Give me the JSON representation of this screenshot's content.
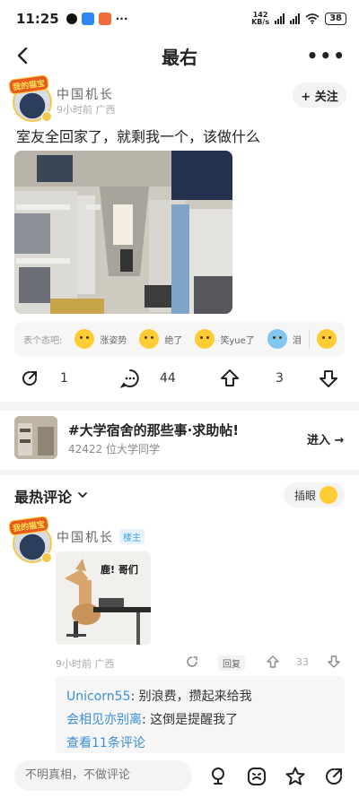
{
  "status": {
    "time": "11:25",
    "net_rate": "142",
    "net_unit": "KB/s",
    "battery": "38"
  },
  "header": {
    "title": "最右",
    "more": "•••"
  },
  "post": {
    "author": "中国机长",
    "avatar_badge": "我的猫宝",
    "meta": "9小时前 广西",
    "follow_label": "+ 关注",
    "title": "室友全回家了，就剩我一个，该做什么",
    "reactions": {
      "prompt": "表个态吧:",
      "items": [
        "涨姿势",
        "绝了",
        "笑yue了",
        "泪"
      ]
    },
    "actions": {
      "share_count": "1",
      "comment_count": "44",
      "upvote_count": "3"
    }
  },
  "forum": {
    "name": "#大学宿舍的那些事·求助帖!",
    "subtitle": "42422 位大学同学",
    "enter_label": "进入 →"
  },
  "comments": {
    "section_title": "最热评论",
    "insert_label": "插眼",
    "items": [
      {
        "author": "中国机长",
        "badge": "楼主",
        "image_caption": "鹿! 哥们",
        "meta": "9小时前 广西",
        "reply_label": "回复",
        "upvotes": "33",
        "replies": [
          {
            "user": "Unicorn55",
            "text": ": 别浪费，攒起来给我"
          },
          {
            "user": "会相见亦别离",
            "text": ": 这倒是提醒我了"
          }
        ],
        "more_replies": "查看11条评论"
      }
    ]
  },
  "bottom": {
    "input_placeholder": "不明真相，不做评论"
  },
  "colors": {
    "link": "#3a8fd8",
    "badge_bg": "#e7f3fc",
    "emoji": "#ffcc33",
    "divider": "#f5f5f5"
  }
}
